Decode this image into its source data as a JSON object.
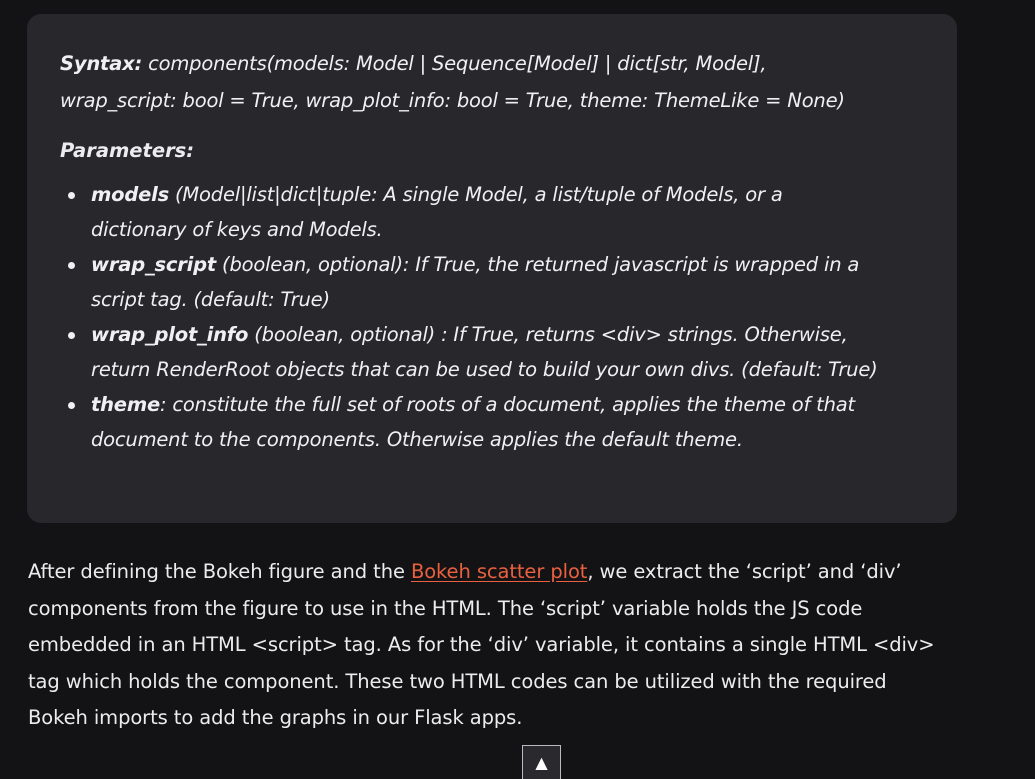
{
  "syntax_box": {
    "syntax_label": "Syntax:",
    "syntax_line1": " components(models: Model | Sequence[Model] | dict[str, Model],",
    "syntax_line2": "wrap_script: bool = True, wrap_plot_info: bool = True, theme: ThemeLike = None)",
    "params_title": "Parameters:",
    "params": [
      {
        "name": "models",
        "desc_line1": " (Model|list|dict|tuple: A single Model, a list/tuple of Models, or a",
        "desc_line2": "dictionary of keys and Models."
      },
      {
        "name": "wrap_script",
        "desc_line1": " (boolean, optional): If True, the returned javascript is wrapped in a",
        "desc_line2": "script tag. (default: True)"
      },
      {
        "name": "wrap_plot_info",
        "desc_line1": " (boolean, optional) : If True, returns <div> strings. Otherwise,",
        "desc_line2": "return RenderRoot objects that can be used to build your own divs. (default: True)"
      },
      {
        "name": "theme",
        "desc_line1": ": constitute the full set of roots of a document, applies the theme of that",
        "desc_line2": "document to the components. Otherwise applies the default theme."
      }
    ]
  },
  "paragraph": {
    "line1_before": "After defining the Bokeh figure and the ",
    "link_text": "Bokeh scatter plot",
    "line1_after": ", we extract the ‘script’ and ‘div’",
    "line2": "components from the figure to use in the HTML. The ‘script’ variable holds the JS code",
    "line3": "embedded in an HTML <script> tag. As for the ‘div’ variable, it contains a single HTML <div>",
    "line4": "tag which holds the component. These two HTML codes can be utilized with the required",
    "line5": "Bokeh imports to add the graphs in our Flask apps."
  },
  "back_to_top": {
    "glyph": "▲"
  },
  "colors": {
    "page_bg": "#131315",
    "box_bg": "#28282c",
    "link": "#e9613f",
    "text": "#ececee"
  }
}
